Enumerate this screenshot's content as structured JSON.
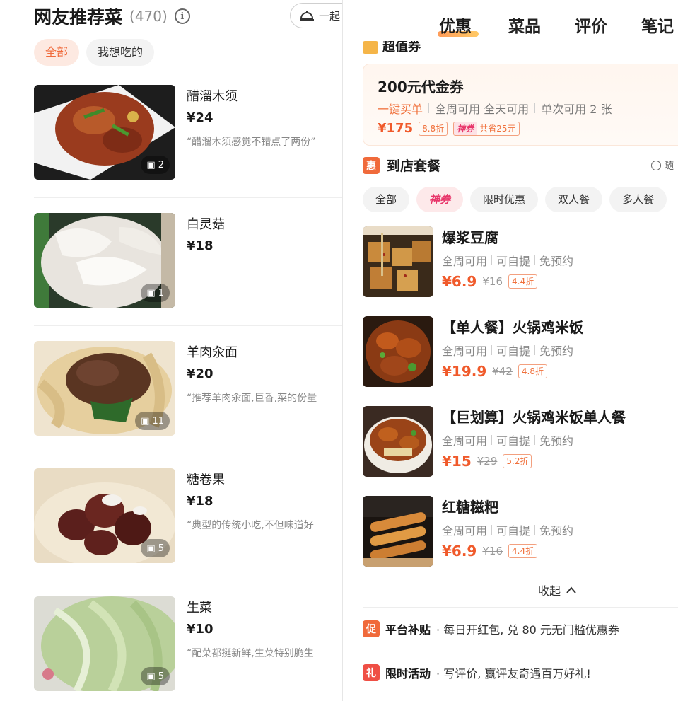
{
  "left": {
    "title": "网友推荐菜",
    "count": "(470)",
    "info_glyph": "i",
    "order_button": "一起",
    "filters": [
      "全部",
      "我想吃的"
    ],
    "dishes": [
      {
        "name": "醋溜木须",
        "price": "¥24",
        "review": "“醋溜木须感觉不错点了两份”",
        "images": "2"
      },
      {
        "name": "白灵菇",
        "price": "¥18",
        "review": "",
        "images": "1"
      },
      {
        "name": "羊肉汆面",
        "price": "¥20",
        "review": "“推荐羊肉汆面,巨香,菜的份量",
        "images": "11"
      },
      {
        "name": "糖卷果",
        "price": "¥18",
        "review": "“典型的传统小吃,不但味道好",
        "images": "5"
      },
      {
        "name": "生菜",
        "price": "¥10",
        "review": "“配菜都挺新鲜,生菜特别脆生",
        "images": "5"
      }
    ]
  },
  "right": {
    "tabs": [
      "优惠",
      "菜品",
      "评价",
      "笔记"
    ],
    "peek_title": "超值券",
    "voucher": {
      "title": "200元代金券",
      "one_click": "一键买单",
      "meta1": "全周可用 全天可用",
      "meta2": "单次可用 2 张",
      "price": "¥175",
      "discount": "8.8折",
      "shen": "神券",
      "save": "共省25元"
    },
    "package_icon": "惠",
    "package_title": "到店套餐",
    "package_right": "随",
    "filters": [
      "全部",
      "神券",
      "限时优惠",
      "双人餐",
      "多人餐"
    ],
    "deals": [
      {
        "name": "爆浆豆腐",
        "meta": [
          "全周可用",
          "可自提",
          "免预约"
        ],
        "price": "¥6.9",
        "orig": "¥16",
        "discount": "4.4折"
      },
      {
        "name": "【单人餐】火锅鸡米饭",
        "meta": [
          "全周可用",
          "可自提",
          "免预约"
        ],
        "price": "¥19.9",
        "orig": "¥42",
        "discount": "4.8折"
      },
      {
        "name": "【巨划算】火锅鸡米饭单人餐",
        "meta": [
          "全周可用",
          "可自提",
          "免预约"
        ],
        "price": "¥15",
        "orig": "¥29",
        "discount": "5.2折"
      },
      {
        "name": "红糖糍粑",
        "meta": [
          "全周可用",
          "可自提",
          "免预约"
        ],
        "price": "¥6.9",
        "orig": "¥16",
        "discount": "4.4折"
      }
    ],
    "collapse_label": "收起",
    "promos": [
      {
        "icon": "促",
        "title": "平台补贴",
        "text": "· 每日开红包, 兑 80 元无门槛优惠券"
      },
      {
        "icon": "礼",
        "title": "限时活动",
        "text": "· 写评价, 赢评友奇遇百万好礼!"
      }
    ]
  },
  "colors": {
    "accent_orange": "#f05a2b",
    "chip_active_bg": "#fde9e1",
    "shen_pink": "#e8356a"
  }
}
